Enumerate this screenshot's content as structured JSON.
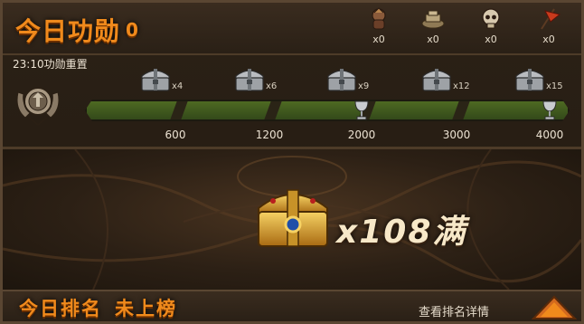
{
  "header": {
    "title": "今日功勋",
    "merit_value": "0",
    "stats": [
      {
        "icon": "warrior-icon",
        "count": "x0"
      },
      {
        "icon": "gold-pile-icon",
        "count": "x0"
      },
      {
        "icon": "skull-icon",
        "count": "x0"
      },
      {
        "icon": "war-flag-icon",
        "count": "x0"
      }
    ],
    "reset_text": "23:10功勋重置"
  },
  "progress": {
    "progress_fraction": 0,
    "milestones": [
      {
        "points": "600",
        "chest_mult": "x4",
        "has_goblet": false
      },
      {
        "points": "1200",
        "chest_mult": "x6",
        "has_goblet": false
      },
      {
        "points": "2000",
        "chest_mult": "x9",
        "has_goblet": true
      },
      {
        "points": "3000",
        "chest_mult": "x12",
        "has_goblet": false
      },
      {
        "points": "4000",
        "chest_mult": "x15",
        "has_goblet": true
      }
    ]
  },
  "reward": {
    "quantity": "x108满"
  },
  "footer": {
    "rank_label": "今日排名",
    "rank_value": "未上榜",
    "details_link": "查看排名详情"
  },
  "colors": {
    "title_orange": "#f08a1c",
    "bar_green": "#4e6a22",
    "panel_brown": "#2b2116"
  }
}
